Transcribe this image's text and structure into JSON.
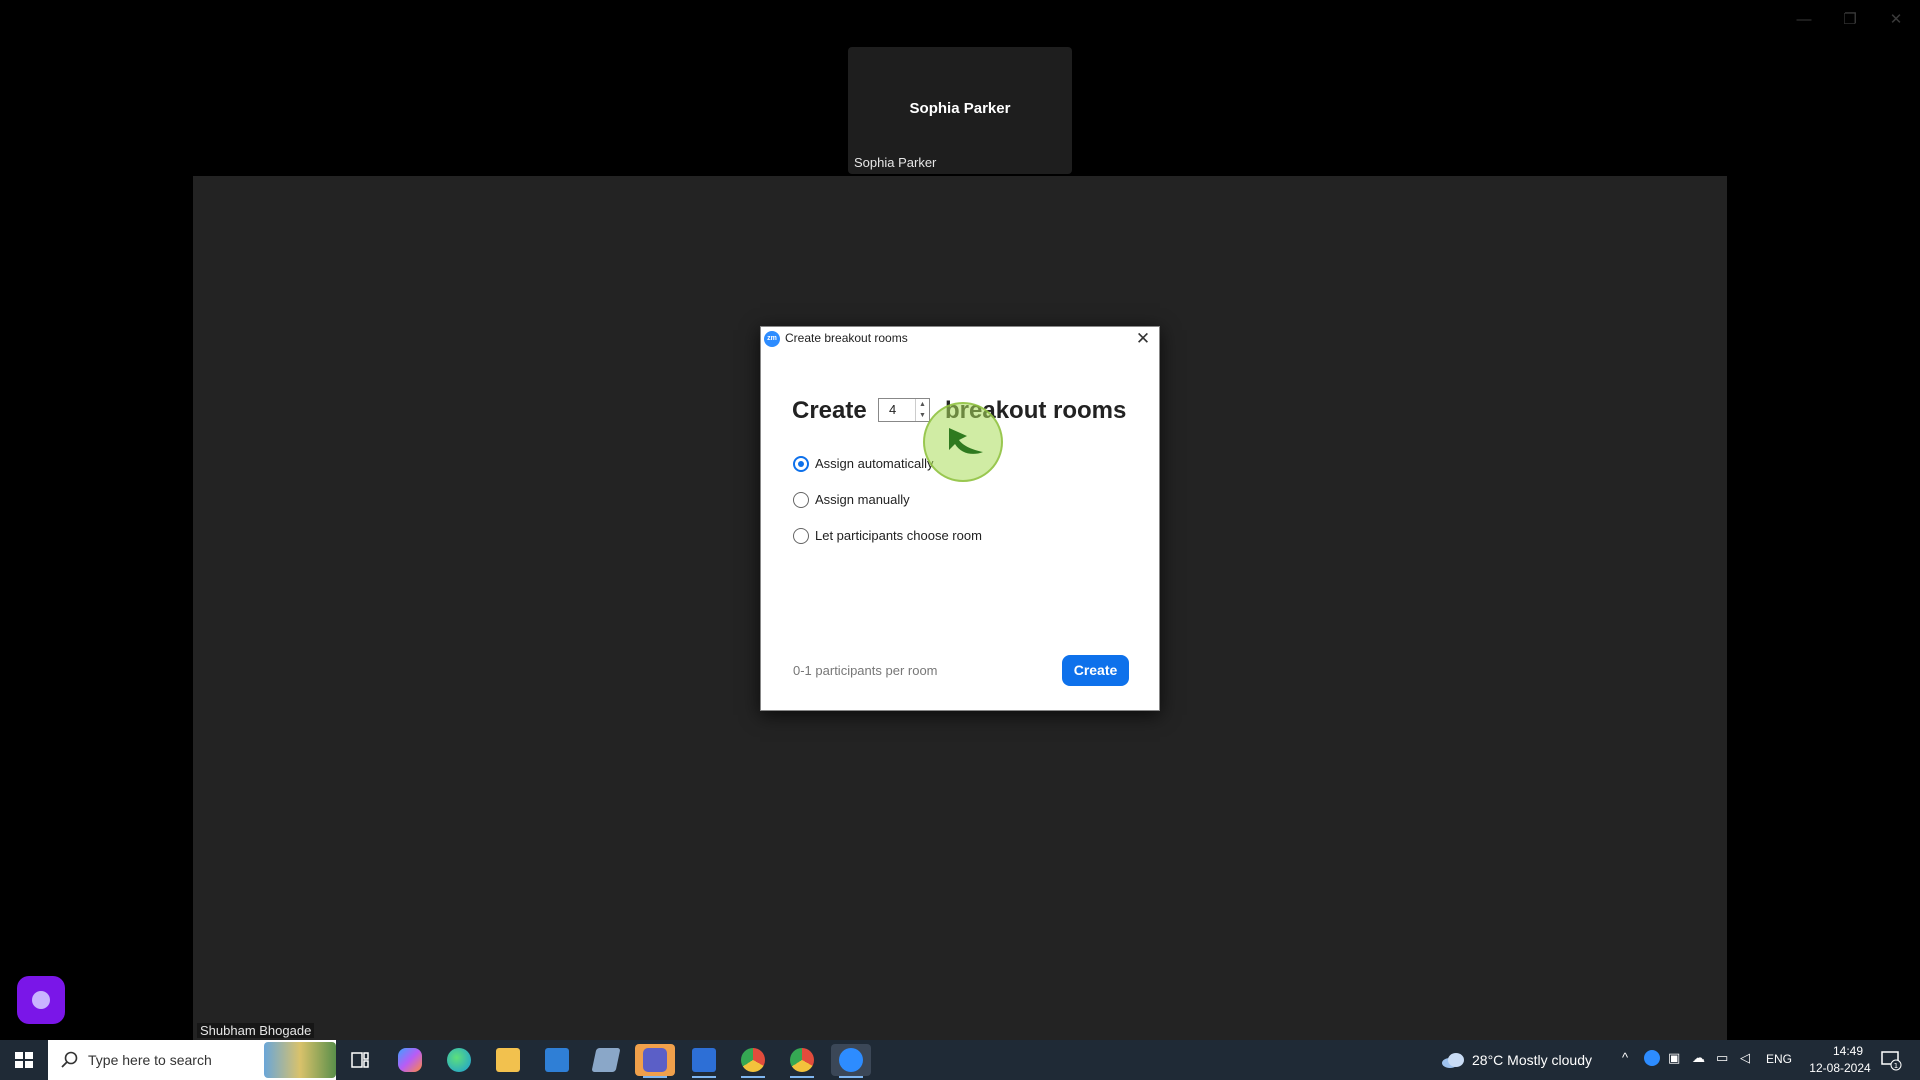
{
  "window_controls": {
    "minimize": "—",
    "restore": "❐",
    "close": "✕"
  },
  "participant_tile": {
    "display_name": "Sophia Parker",
    "name_label": "Sophia Parker"
  },
  "main_video": {
    "name_label": "Shubham Bhogade"
  },
  "dialog": {
    "app_icon": "zm",
    "title": "Create breakout rooms",
    "close_glyph": "✕",
    "heading_prefix": "Create",
    "rooms_count": "4",
    "heading_suffix": "breakout rooms",
    "options": [
      {
        "label": "Assign automatically",
        "selected": true
      },
      {
        "label": "Assign manually",
        "selected": false
      },
      {
        "label": "Let participants choose room",
        "selected": false
      }
    ],
    "participants_per_room": "0-1 participants per room",
    "create_button": "Create"
  },
  "taskbar": {
    "search_placeholder": "Type here to search",
    "weather": "28°C  Mostly cloudy",
    "language": "ENG",
    "time": "14:49",
    "date": "12-08-2024",
    "notification_count": "1",
    "apps": [
      {
        "name": "task-view-icon"
      },
      {
        "name": "copilot-icon",
        "color": "#8a5cf6"
      },
      {
        "name": "edge-icon",
        "color": "#1a9bd7"
      },
      {
        "name": "file-explorer-icon",
        "color": "#f2c14e"
      },
      {
        "name": "mail-icon",
        "color": "#2f7fd6"
      },
      {
        "name": "generic-app-icon",
        "color": "#8aa7c8"
      },
      {
        "name": "teams-icon",
        "color": "#5b5fc7"
      },
      {
        "name": "remote-app-icon",
        "color": "#2d6fd6"
      },
      {
        "name": "chrome-icon",
        "color": "#e24c3c"
      },
      {
        "name": "chrome-profile-icon",
        "color": "#e24c3c"
      },
      {
        "name": "zoom-icon",
        "color": "#2d8cff"
      }
    ]
  }
}
